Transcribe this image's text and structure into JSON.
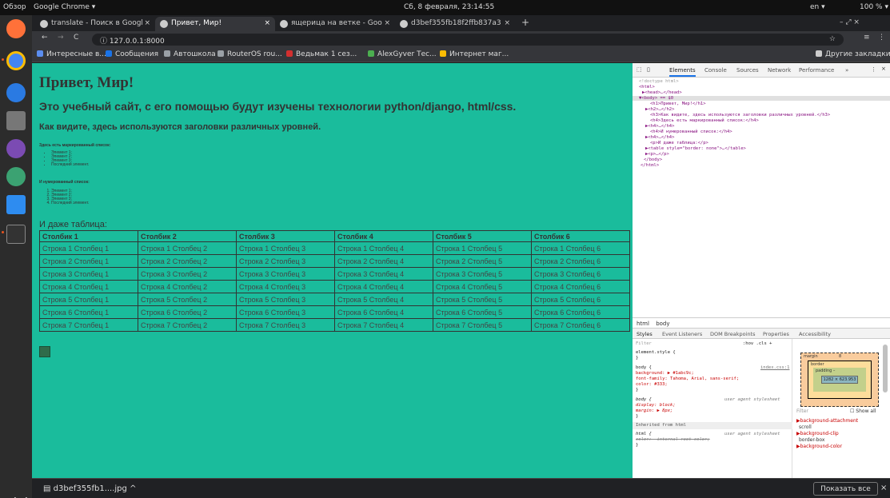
{
  "topbar": {
    "activities": "Обзор",
    "app": "Google Chrome ▾",
    "clock": "Сб, 8 февраля, 23:14:55",
    "lang": "en ▾",
    "battery": "100 % ▾"
  },
  "tabs": [
    {
      "label": "translate - Поиск в Googl",
      "close": "×"
    },
    {
      "label": "Привет, Мир!",
      "close": "×"
    },
    {
      "label": "ящерица на ветке - Goo",
      "close": "×"
    },
    {
      "label": "d3bef355fb18f2ffb837a3",
      "close": "×"
    }
  ],
  "new_tab": "+",
  "window_controls": "–  ⤢  ×",
  "address": "127.0.0.1:8000",
  "bookmarks": [
    {
      "label": "Интересные в...",
      "color": "#5b8def"
    },
    {
      "label": "Сообщения",
      "color": "#1a73e8"
    },
    {
      "label": "Автошкола",
      "color": "#9aa0a6"
    },
    {
      "label": "RouterOS rou...",
      "color": "#9aa0a6"
    },
    {
      "label": "Ведьмак 1 сез...",
      "color": "#d32f2f"
    },
    {
      "label": "AlexGyver Тес...",
      "color": "#4caf50"
    },
    {
      "label": "Интернет маг...",
      "color": "#fbbc04"
    }
  ],
  "other_bookmarks": "Другие закладки",
  "page": {
    "h1": "Привет, Мир!",
    "h2": "Это учебный сайт, с его помощью будут изучены технологии python/django, html/css.",
    "h3": "Как видите, здесь используются заголовки различных уровней.",
    "h4_list": "Здесь есть маркированный список:",
    "ul": [
      "Элемент 1;",
      "Элемент 2;",
      "Элемент 3;",
      "Последний элемент."
    ],
    "h4_numbered": "И нумерованный список:",
    "ol": [
      "Элемент 1;",
      "Элемент 2;",
      "Элемент 3;",
      "Последний элемент."
    ],
    "table_intro": "И даже таблица:",
    "headers": [
      "Столбик 1",
      "Столбик 2",
      "Столбик 3",
      "Столбик 4",
      "Столбик 5",
      "Столбик 6"
    ],
    "rows": [
      [
        "Строка 1 Столбец 1",
        "Строка 1 Столбец 2",
        "Строка 1 Столбец 3",
        "Строка 1 Столбец 4",
        "Строка 1 Столбец 5",
        "Строка 1 Столбец 6"
      ],
      [
        "Строка 2 Столбец 1",
        "Строка 2 Столбец 2",
        "Строка 2 Столбец 3",
        "Строка 2 Столбец 4",
        "Строка 2 Столбец 5",
        "Строка 2 Столбец 6"
      ],
      [
        "Строка 3 Столбец 1",
        "Строка 3 Столбец 2",
        "Строка 3 Столбец 3",
        "Строка 3 Столбец 4",
        "Строка 3 Столбец 5",
        "Строка 3 Столбец 6"
      ],
      [
        "Строка 4 Столбец 1",
        "Строка 4 Столбец 2",
        "Строка 4 Столбец 3",
        "Строка 4 Столбец 4",
        "Строка 4 Столбец 5",
        "Строка 4 Столбец 6"
      ],
      [
        "Строка 5 Столбец 1",
        "Строка 5 Столбец 2",
        "Строка 5 Столбец 3",
        "Строка 5 Столбец 4",
        "Строка 5 Столбец 5",
        "Строка 5 Столбец 6"
      ],
      [
        "Строка 6 Столбец 1",
        "Строка 6 Столбец 2",
        "Строка 6 Столбец 3",
        "Строка 6 Столбец 4",
        "Строка 6 Столбец 5",
        "Строка 6 Столбец 6"
      ],
      [
        "Строка 7 Столбец 1",
        "Строка 7 Столбец 2",
        "Строка 7 Столбец 3",
        "Строка 7 Столбец 4",
        "Строка 7 Столбец 5",
        "Строка 7 Столбец 6"
      ]
    ],
    "background": "#1abc9c"
  },
  "devtools": {
    "tabs": [
      "Elements",
      "Console",
      "Sources",
      "Network",
      "Performance",
      "»"
    ],
    "dom": [
      "<!doctype html>",
      "<html>",
      "▶<head>…</head>",
      "▼<body> == $0",
      "<h1>Привет, Мир!</h1>",
      "▶<h2>…</h2>",
      "<h3>Как видите, здесь используются заголовки различных уровней.</h3>",
      "<h4>Здесь есть маркированный список:</h4>",
      "▶<h4>…</h4>",
      "<h4>И нумерованный список:</h4>",
      "▶<h4>…</h4>",
      "<p>И даже таблица:</p>",
      "▶<table style=\"border: none\">…</table>",
      "▶<p>…</p>",
      "</body>",
      "</html>"
    ],
    "breadcrumb": [
      "html",
      "body"
    ],
    "style_tabs": [
      "Styles",
      "Event Listeners",
      "DOM Breakpoints",
      "Properties",
      "Accessibility"
    ],
    "filter_placeholder": "Filter",
    "hov_cls": ":hov .cls +",
    "styles": [
      "element.style {",
      "}",
      "body {",
      "  background: ▶ #1abc9c;",
      "  font-family: Tahoma, Arial, sans-serif;",
      "  color: #333;",
      "}",
      "body {",
      "  display: block;",
      "  margin: ▶ 8px;",
      "}",
      "Inherited from html",
      "html {",
      "  color: -internal-root-color;",
      "}"
    ],
    "index_link": "index.css:1",
    "ua_label": "user agent stylesheet",
    "box": {
      "margin": "margin",
      "margin_val": "8",
      "border": "border",
      "border_val": "–",
      "padding": "padding –",
      "content": "1282 × 623.953"
    },
    "right_filter": "Filter",
    "show_all": "Show all",
    "computed": [
      "▶background-attachment",
      "scroll",
      "▶background-clip",
      "border-box",
      "▶background-color"
    ]
  },
  "download": {
    "file": "d3bef355fb1....jpg",
    "chevron": "^",
    "show_all": "Показать все",
    "close": "×"
  }
}
